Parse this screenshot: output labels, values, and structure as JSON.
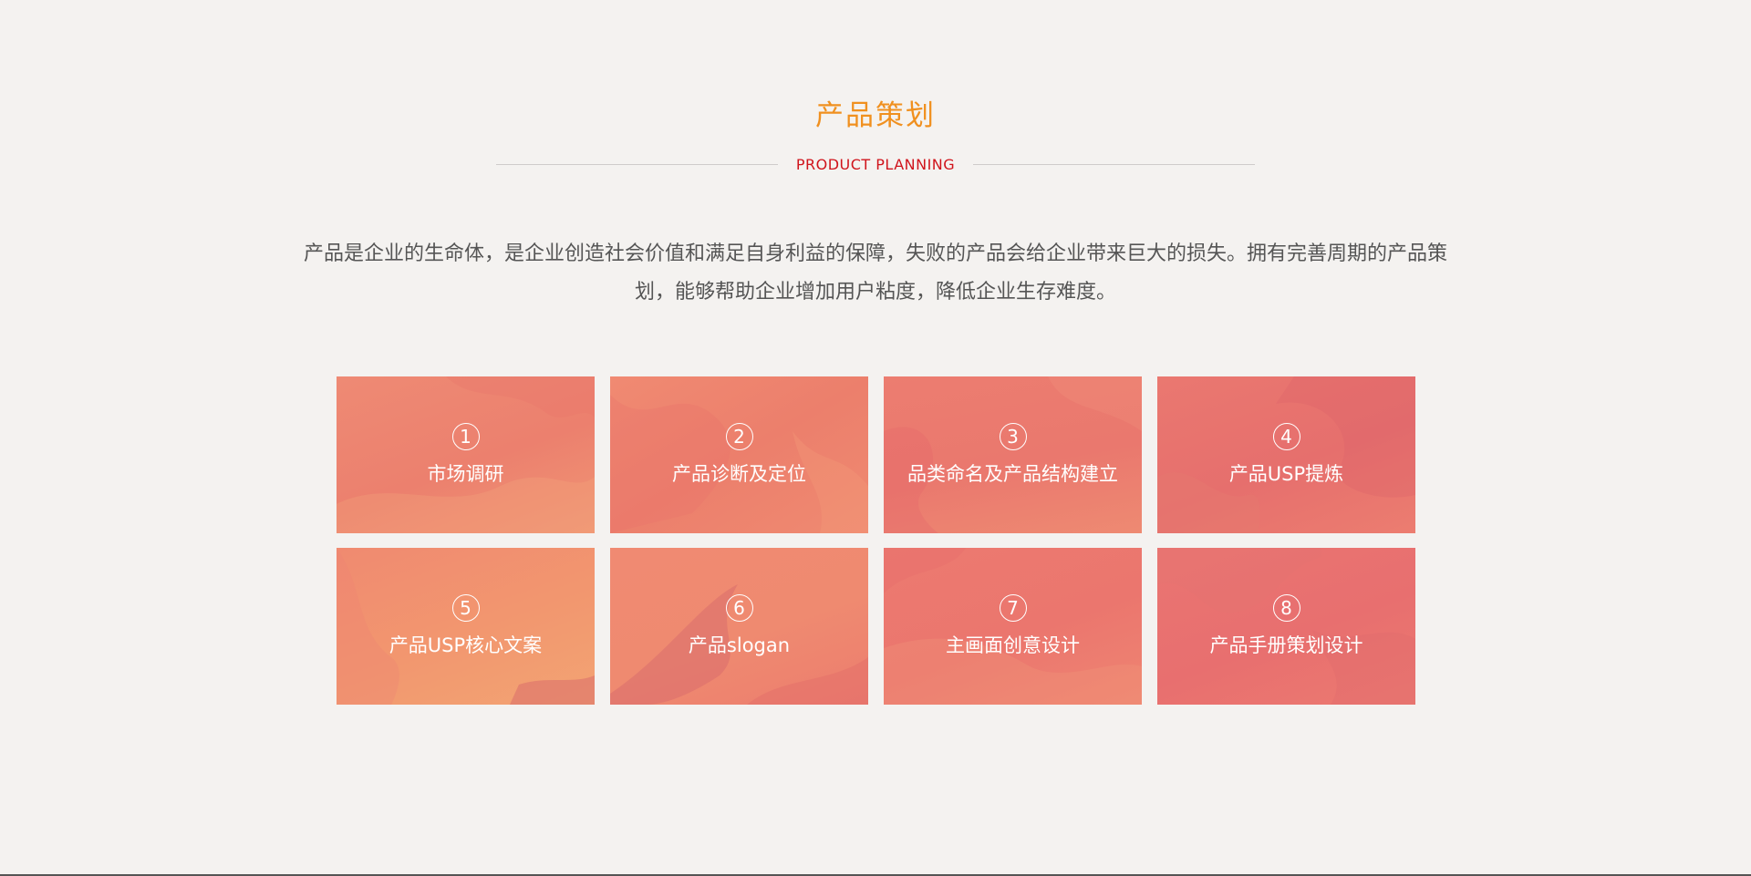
{
  "section": {
    "title": "产品策划",
    "subtitle": "PRODUCT PLANNING",
    "description_line1": "产品是企业的生命体，是企业创造社会价值和满足自身利益的保障，失败的产品会给企业带来巨大的损失。拥有完善周期的产品策",
    "description_line2": "划，能够帮助企业增加用户粘度，降低企业生存难度。"
  },
  "cards": [
    {
      "number": "1",
      "label": "市场调研"
    },
    {
      "number": "2",
      "label": "产品诊断及定位"
    },
    {
      "number": "3",
      "label": "品类命名及产品结构建立"
    },
    {
      "number": "4",
      "label": "产品USP提炼"
    },
    {
      "number": "5",
      "label": "产品USP核心文案"
    },
    {
      "number": "6",
      "label": "产品slogan"
    },
    {
      "number": "7",
      "label": "主画面创意设计"
    },
    {
      "number": "8",
      "label": "产品手册策划设计"
    }
  ],
  "colors": {
    "title": "#f0901f",
    "subtitle": "#d0141c",
    "description": "#555555",
    "background": "#f4f2f0",
    "card_base": "#ec7d70"
  }
}
